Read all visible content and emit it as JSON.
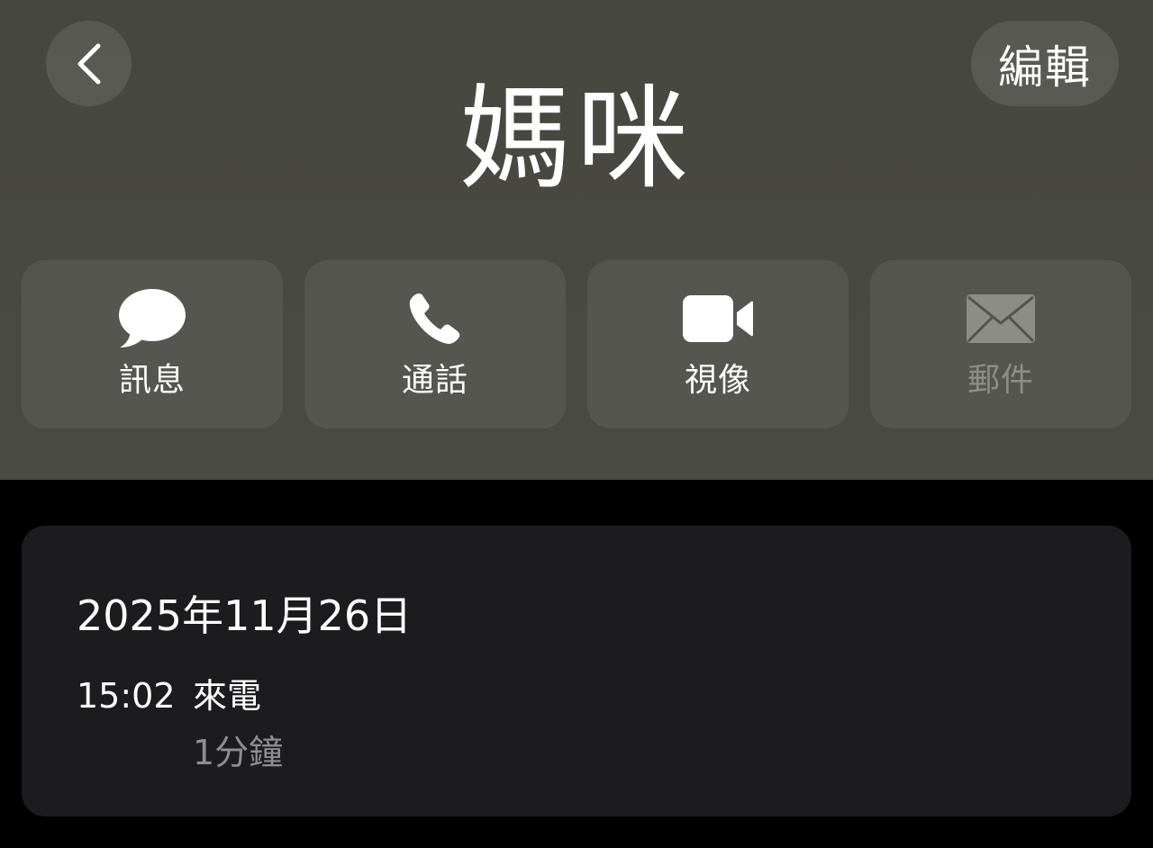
{
  "header": {
    "back_icon": "chevron-left-icon",
    "edit_label": "編輯",
    "contact_name": "媽咪"
  },
  "actions": [
    {
      "label": "訊息",
      "icon": "message-bubble-icon",
      "enabled": true
    },
    {
      "label": "通話",
      "icon": "phone-icon",
      "enabled": true
    },
    {
      "label": "視像",
      "icon": "video-camera-icon",
      "enabled": true
    },
    {
      "label": "郵件",
      "icon": "envelope-icon",
      "enabled": false
    }
  ],
  "call_log": {
    "date": "2025年11月26日",
    "entries": [
      {
        "time": "15:02",
        "type": "來電",
        "duration": "1分鐘"
      }
    ]
  },
  "colors": {
    "header_bg": "#46473f",
    "card_bg": "#1c1c1e",
    "disabled_text": "#8c8d87",
    "secondary_text": "#8e8e93"
  }
}
